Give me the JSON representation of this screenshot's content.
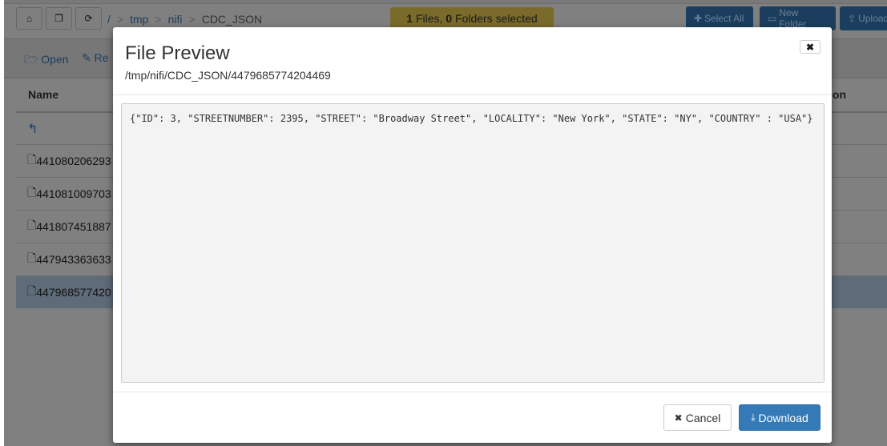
{
  "toolbar": {
    "home_icon": "home-icon",
    "copy_icon": "copy-icon",
    "refresh_icon": "refresh-icon"
  },
  "breadcrumb": {
    "root": "/",
    "items": [
      "tmp",
      "nifi",
      "CDC_JSON"
    ],
    "sep": ">"
  },
  "selection": {
    "files": "1",
    "files_label": " Files, ",
    "folders": "0",
    "folders_label": " Folders selected"
  },
  "actions": {
    "select_all": "Select All",
    "new_folder": "New Folder",
    "upload": "Upload",
    "open": "Open",
    "rename": "Re"
  },
  "table": {
    "name_header": "Name",
    "right_header": "ion",
    "rows": [
      "441080206293",
      "441081009703",
      "441807451887",
      "447943363633",
      "447968577420"
    ]
  },
  "modal": {
    "title": "File Preview",
    "path": "/tmp/nifi/CDC_JSON/4479685774204469",
    "content": "{\"ID\": 3, \"STREETNUMBER\": 2395, \"STREET\": \"Broadway Street\", \"LOCALITY\": \"New York\", \"STATE\": \"NY\", \"COUNTRY\" : \"USA\"}",
    "cancel": "Cancel",
    "download": "Download"
  },
  "colors": {
    "primary": "#337ab7",
    "selection": "#f0d050"
  }
}
